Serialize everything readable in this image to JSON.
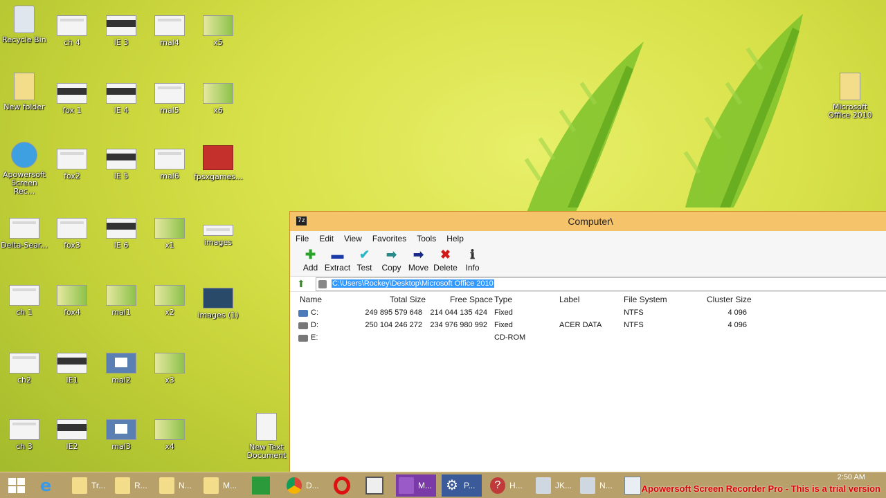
{
  "desktop_icons": [
    {
      "label": "Recycle Bin"
    },
    {
      "label": "ch 4"
    },
    {
      "label": "IE 3"
    },
    {
      "label": "mal4"
    },
    {
      "label": "x5"
    },
    {
      "label": "New folder"
    },
    {
      "label": "fox 1"
    },
    {
      "label": "IE 4"
    },
    {
      "label": "mal5"
    },
    {
      "label": "x6"
    },
    {
      "label": "Apowersoft Screen Rec..."
    },
    {
      "label": "fox2"
    },
    {
      "label": "IE 5"
    },
    {
      "label": "mal6"
    },
    {
      "label": "fpsxgames..."
    },
    {
      "label": "Delta-Sear..."
    },
    {
      "label": "fox3"
    },
    {
      "label": "IE 6"
    },
    {
      "label": "x1"
    },
    {
      "label": "images"
    },
    {
      "label": "ch 1"
    },
    {
      "label": "fox4"
    },
    {
      "label": "mal1"
    },
    {
      "label": "x2"
    },
    {
      "label": "images (1)"
    },
    {
      "label": "ch2"
    },
    {
      "label": "IE1"
    },
    {
      "label": "mal2"
    },
    {
      "label": "x3"
    },
    {
      "label": "ch 3"
    },
    {
      "label": "IE2"
    },
    {
      "label": "mal3"
    },
    {
      "label": "x4"
    },
    {
      "label": "New Text Document"
    },
    {
      "label": "Microsoft Office 2010"
    }
  ],
  "window": {
    "app_icon": "7z",
    "title": "Computer\\",
    "menu": [
      "File",
      "Edit",
      "View",
      "Favorites",
      "Tools",
      "Help"
    ],
    "toolbar": [
      {
        "label": "Add",
        "icon": "plus-icon"
      },
      {
        "label": "Extract",
        "icon": "minus-icon"
      },
      {
        "label": "Test",
        "icon": "check-icon"
      },
      {
        "label": "Copy",
        "icon": "copy-arrow-icon"
      },
      {
        "label": "Move",
        "icon": "move-arrow-icon"
      },
      {
        "label": "Delete",
        "icon": "delete-x-icon"
      },
      {
        "label": "Info",
        "icon": "info-icon"
      }
    ],
    "address": "C:\\Users\\Rockey\\Desktop\\Microsoft Office 2010",
    "columns": [
      "Name",
      "Total Size",
      "Free Space",
      "Type",
      "Label",
      "File System",
      "Cluster Size"
    ],
    "rows": [
      {
        "name": "C:",
        "total": "249 895 579 648",
        "free": "214 044 135 424",
        "type": "Fixed",
        "label": "",
        "fs": "NTFS",
        "cluster": "4 096"
      },
      {
        "name": "D:",
        "total": "250 104 246 272",
        "free": "234 976 980 992",
        "type": "Fixed",
        "label": "ACER DATA",
        "fs": "NTFS",
        "cluster": "4 096"
      },
      {
        "name": "E:",
        "total": "",
        "free": "",
        "type": "CD-ROM",
        "label": "",
        "fs": "",
        "cluster": ""
      }
    ]
  },
  "taskbar": {
    "items": [
      {
        "label": "Tr..."
      },
      {
        "label": "R..."
      },
      {
        "label": "N..."
      },
      {
        "label": "M..."
      },
      {
        "label": "D..."
      },
      {
        "label": "M..."
      },
      {
        "label": "P..."
      },
      {
        "label": "H..."
      },
      {
        "label": "JK..."
      },
      {
        "label": "N..."
      }
    ],
    "clock": "2:50 AM",
    "trial_notice": "Apowersoft Screen Recorder Pro - This is a trial version"
  }
}
